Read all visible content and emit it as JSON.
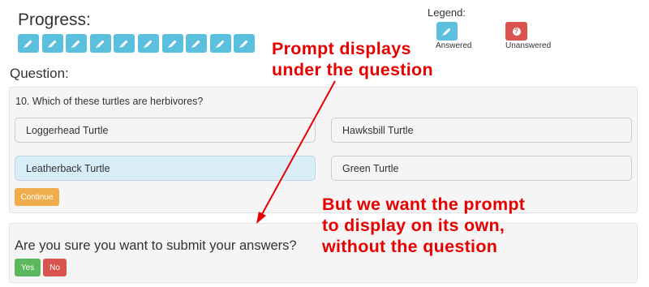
{
  "progress": {
    "title": "Progress:",
    "question_count": 10,
    "icon": "pencil-icon",
    "color": "#5bc0de"
  },
  "legend": {
    "title": "Legend:",
    "answered_label": "Answered",
    "unanswered_label": "Unanswered",
    "answered_color": "#5bc0de",
    "unanswered_color": "#d9534f",
    "answered_icon": "pencil-icon",
    "unanswered_icon": "question-circle-icon"
  },
  "question": {
    "heading": "Question:",
    "text": "10. Which of these turtles are herbivores?",
    "answers": [
      "Loggerhead Turtle",
      "Hawksbill Turtle",
      "Leatherback Turtle",
      "Green Turtle"
    ],
    "selected": "Leatherback Turtle",
    "continue_label": "Continue"
  },
  "confirm": {
    "text": "Are you sure you want to submit your answers?",
    "yes_label": "Yes",
    "no_label": "No"
  },
  "annotations": {
    "top": "Prompt displays\nunder the question",
    "bottom": "But we want the prompt\nto display on its own,\nwithout the question",
    "color": "#e60000"
  }
}
